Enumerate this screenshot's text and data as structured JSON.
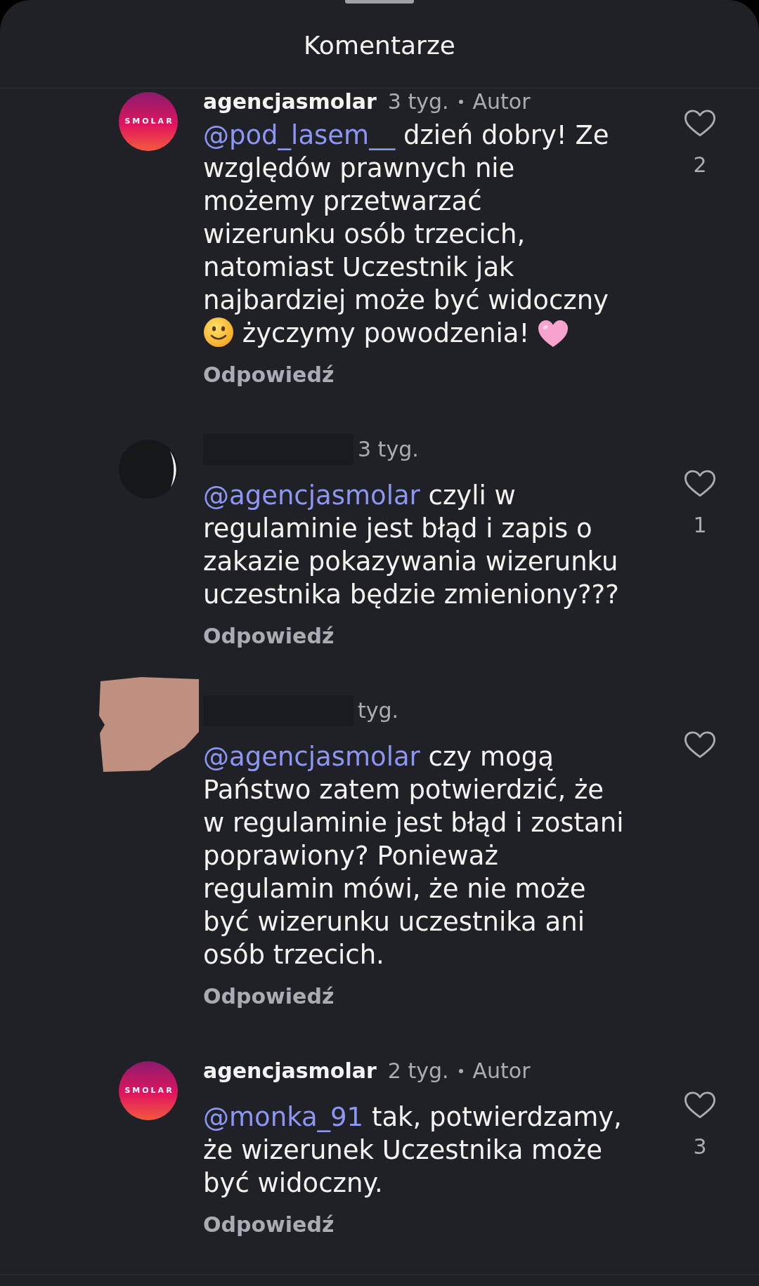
{
  "sheet": {
    "title": "Komentarze"
  },
  "comments": [
    {
      "avatar": {
        "kind": "logo",
        "text": "SMOLAR"
      },
      "author": "agencjasmolar",
      "author_redacted": false,
      "time": "3 tyg.",
      "badge": "Autor",
      "body": [
        {
          "kind": "mention",
          "text": "@pod_lasem__"
        },
        {
          "kind": "text",
          "text": " dzień dobry! Ze\nwzględów prawnych nie\nmożemy przetwarzać\nwizerunku osób trzecich,\nnatomiast Uczestnik jak\nnajbardziej może być widoczny\n"
        },
        {
          "kind": "smiley"
        },
        {
          "kind": "text",
          "text": " życzymy powodzenia! "
        },
        {
          "kind": "heart"
        }
      ],
      "reply": "Odpowiedź",
      "liked": false,
      "likes": "2"
    },
    {
      "avatar": {
        "kind": "blackout"
      },
      "author_redacted": true,
      "time": "3 tyg.",
      "body": [
        {
          "kind": "mention",
          "text": "@agencjasmolar"
        },
        {
          "kind": "text",
          "text": " czyli w\nregulaminie jest błąd i zapis o\nzakazie pokazywania wizerunku\nuczestnika będzie zmieniony???"
        }
      ],
      "reply": "Odpowiedź",
      "liked": false,
      "likes": "1"
    },
    {
      "avatar": {
        "kind": "smudge"
      },
      "author_redacted": true,
      "time": "tyg.",
      "body": [
        {
          "kind": "mention",
          "text": "@agencjasmolar"
        },
        {
          "kind": "text",
          "text": " czy mogą\nPaństwo zatem potwierdzić, że\nw regulaminie jest błąd i zostani\npoprawiony? Ponieważ\nregulamin mówi, że nie może\nbyć wizerunku uczestnika ani\nosób trzecich."
        }
      ],
      "reply": "Odpowiedź",
      "liked": false
    },
    {
      "avatar": {
        "kind": "logo",
        "text": "SMOLAR"
      },
      "author": "agencjasmolar",
      "author_redacted": false,
      "time": "2 tyg.",
      "badge": "Autor",
      "body": [
        {
          "kind": "mention",
          "text": "@monka_91"
        },
        {
          "kind": "text",
          "text": " tak, potwierdzamy,\nże wizerunek Uczestnika może\nbyć widoczny."
        }
      ],
      "reply": "Odpowiedź",
      "liked": false,
      "likes": "3"
    }
  ]
}
